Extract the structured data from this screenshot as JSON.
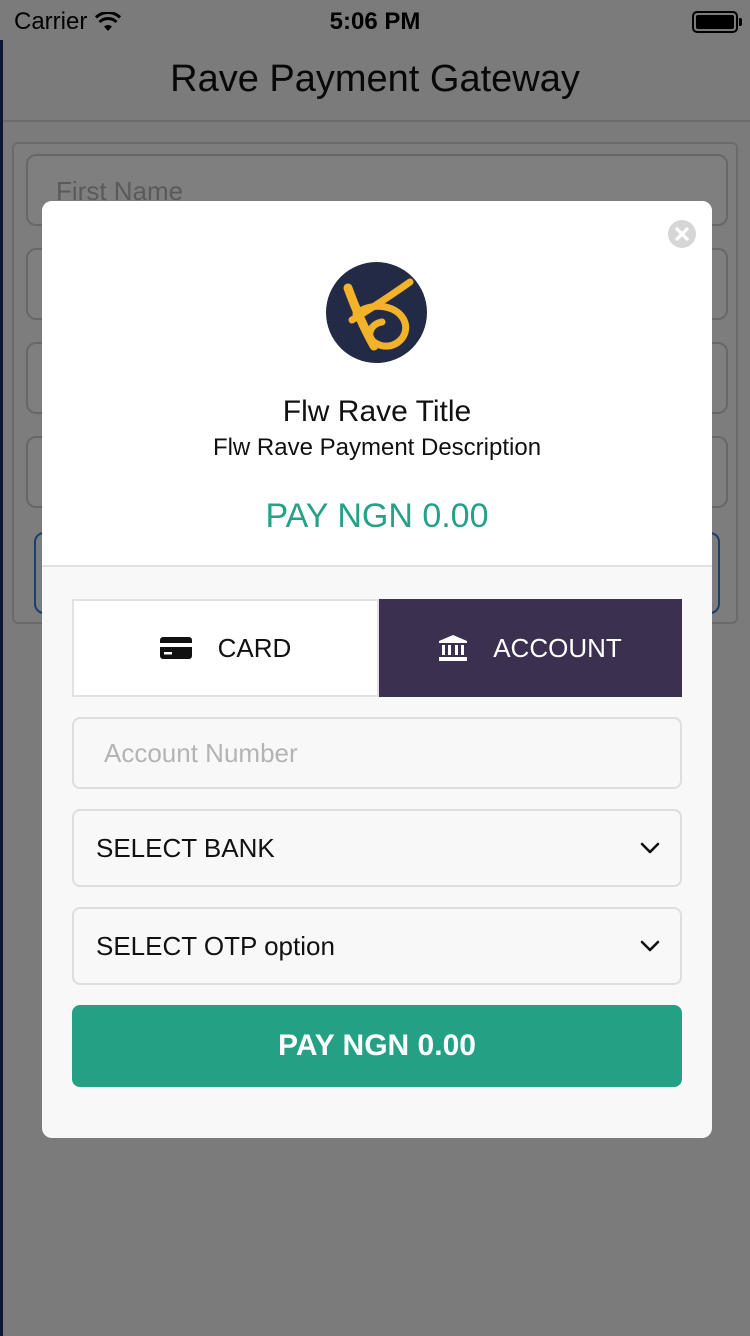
{
  "status_bar": {
    "carrier": "Carrier",
    "time": "5:06 PM"
  },
  "nav": {
    "title": "Rave Payment Gateway"
  },
  "background_form": {
    "first_name_placeholder": "First Name"
  },
  "modal": {
    "title": "Flw Rave Title",
    "description": "Flw Rave Payment Description",
    "amount_label": "PAY NGN 0.00",
    "tabs": [
      {
        "label": "CARD",
        "icon": "credit-card-icon",
        "active": false
      },
      {
        "label": "ACCOUNT",
        "icon": "bank-icon",
        "active": true
      }
    ],
    "account_number_placeholder": "Account Number",
    "select_bank": "SELECT BANK",
    "select_otp": "SELECT OTP option",
    "pay_button": "PAY NGN 0.00"
  },
  "colors": {
    "accent_green": "#24a084",
    "amount_green": "#27a088",
    "active_tab": "#3b3050",
    "logo_bg": "#222a45",
    "logo_mark": "#f2b22a"
  }
}
